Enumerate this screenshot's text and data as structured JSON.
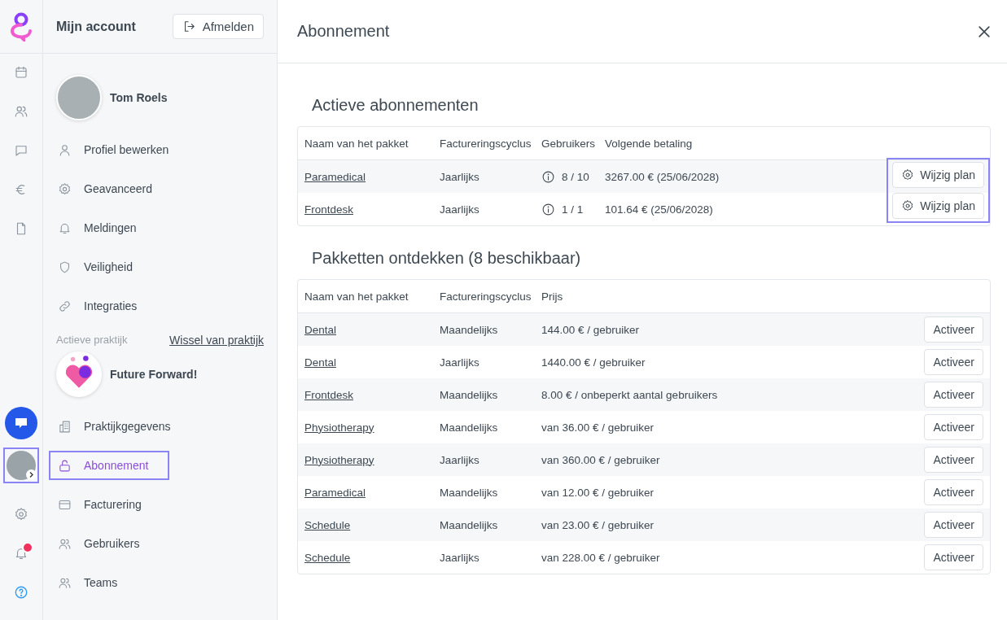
{
  "rail": {
    "top": [
      {
        "kind": "calendar"
      },
      {
        "kind": "users"
      },
      {
        "kind": "chat"
      },
      {
        "kind": "euro"
      },
      {
        "kind": "document"
      }
    ],
    "bottom": [
      {
        "kind": "support",
        "selected": false
      },
      {
        "kind": "avatar",
        "selected": true
      },
      {
        "kind": "settings",
        "selected": false
      },
      {
        "kind": "bell",
        "selected": false,
        "badge": true
      },
      {
        "kind": "help",
        "selected": false
      }
    ]
  },
  "sidebar": {
    "title": "Mijn account",
    "logout": "Afmelden",
    "user": "Tom Roels",
    "items": [
      {
        "label": "Profiel bewerken",
        "kind": "user",
        "selected": false
      },
      {
        "label": "Geavanceerd",
        "kind": "settings",
        "selected": false
      },
      {
        "label": "Meldingen",
        "kind": "bell",
        "selected": false
      },
      {
        "label": "Veiligheid",
        "kind": "shield",
        "selected": false
      },
      {
        "label": "Integraties",
        "kind": "link",
        "selected": false
      }
    ],
    "practice_label": "Actieve praktijk",
    "practice_switch": "Wissel van praktijk",
    "practice_name": "Future Forward!",
    "practice_items": [
      {
        "label": "Praktijkgegevens",
        "kind": "building",
        "selected": false
      },
      {
        "label": "Abonnement",
        "kind": "lock",
        "selected": true
      },
      {
        "label": "Facturering",
        "kind": "card",
        "selected": false
      },
      {
        "label": "Gebruikers",
        "kind": "users",
        "selected": false
      },
      {
        "label": "Teams",
        "kind": "users",
        "selected": false
      }
    ]
  },
  "panel": {
    "title": "Abonnement",
    "active": {
      "title": "Actieve abonnementen",
      "actions_highlighted": true,
      "columns": [
        "Naam van het pakket",
        "Factureringscyclus",
        "Gebruikers",
        "Volgende betaling"
      ],
      "rows": [
        {
          "name": "Paramedical",
          "cycle": "Jaarlijks",
          "users": "8 / 10",
          "payment": "3267.00 € (25/06/2028)",
          "action": "Wijzig plan"
        },
        {
          "name": "Frontdesk",
          "cycle": "Jaarlijks",
          "users": "1 / 1",
          "payment": "101.64 € (25/06/2028)",
          "action": "Wijzig plan"
        }
      ]
    },
    "discover": {
      "title": "Pakketten ontdekken (8 beschikbaar)",
      "columns": [
        "Naam van het pakket",
        "Factureringscyclus",
        "Prijs"
      ],
      "rows": [
        {
          "name": "Dental",
          "cycle": "Maandelijks",
          "price": "144.00 € / gebruiker",
          "action": "Activeer"
        },
        {
          "name": "Dental",
          "cycle": "Jaarlijks",
          "price": "1440.00 € / gebruiker",
          "action": "Activeer"
        },
        {
          "name": "Frontdesk",
          "cycle": "Maandelijks",
          "price": "8.00 € / onbeperkt aantal gebruikers",
          "action": "Activeer"
        },
        {
          "name": "Physiotherapy",
          "cycle": "Maandelijks",
          "price": "van 36.00 € / gebruiker",
          "action": "Activeer"
        },
        {
          "name": "Physiotherapy",
          "cycle": "Jaarlijks",
          "price": "van 360.00 € / gebruiker",
          "action": "Activeer"
        },
        {
          "name": "Paramedical",
          "cycle": "Maandelijks",
          "price": "van 12.00 € / gebruiker",
          "action": "Activeer"
        },
        {
          "name": "Schedule",
          "cycle": "Maandelijks",
          "price": "van 23.00 € / gebruiker",
          "action": "Activeer"
        },
        {
          "name": "Schedule",
          "cycle": "Jaarlijks",
          "price": "van 228.00 € / gebruiker",
          "action": "Activeer"
        }
      ]
    }
  }
}
